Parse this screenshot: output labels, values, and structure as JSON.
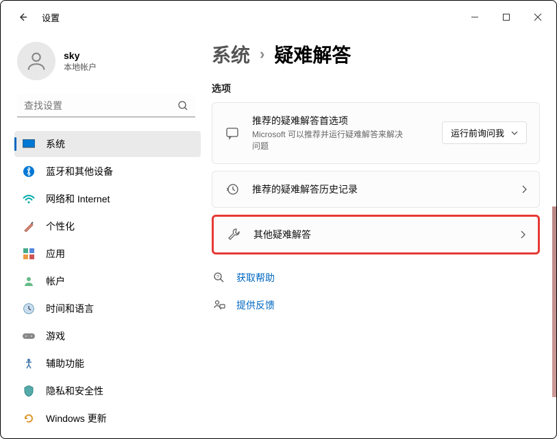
{
  "window": {
    "title": "设置"
  },
  "user": {
    "name": "sky",
    "subtitle": "本地帐户"
  },
  "search": {
    "placeholder": "查找设置"
  },
  "sidebar": {
    "items": [
      {
        "label": "系统",
        "icon": "system",
        "active": true
      },
      {
        "label": "蓝牙和其他设备",
        "icon": "bluetooth"
      },
      {
        "label": "网络和 Internet",
        "icon": "network"
      },
      {
        "label": "个性化",
        "icon": "personalize"
      },
      {
        "label": "应用",
        "icon": "apps"
      },
      {
        "label": "帐户",
        "icon": "accounts"
      },
      {
        "label": "时间和语言",
        "icon": "time"
      },
      {
        "label": "游戏",
        "icon": "gaming"
      },
      {
        "label": "辅助功能",
        "icon": "accessibility"
      },
      {
        "label": "隐私和安全性",
        "icon": "privacy"
      },
      {
        "label": "Windows 更新",
        "icon": "update"
      }
    ]
  },
  "breadcrumb": {
    "parent": "系统",
    "current": "疑难解答"
  },
  "section_label": "选项",
  "cards": {
    "recommended": {
      "title": "推荐的疑难解答首选项",
      "subtitle": "Microsoft 可以推荐并运行疑难解答来解决问题",
      "dropdown": "运行前询问我"
    },
    "history": {
      "title": "推荐的疑难解答历史记录"
    },
    "other": {
      "title": "其他疑难解答"
    }
  },
  "links": {
    "help": "获取帮助",
    "feedback": "提供反馈"
  }
}
